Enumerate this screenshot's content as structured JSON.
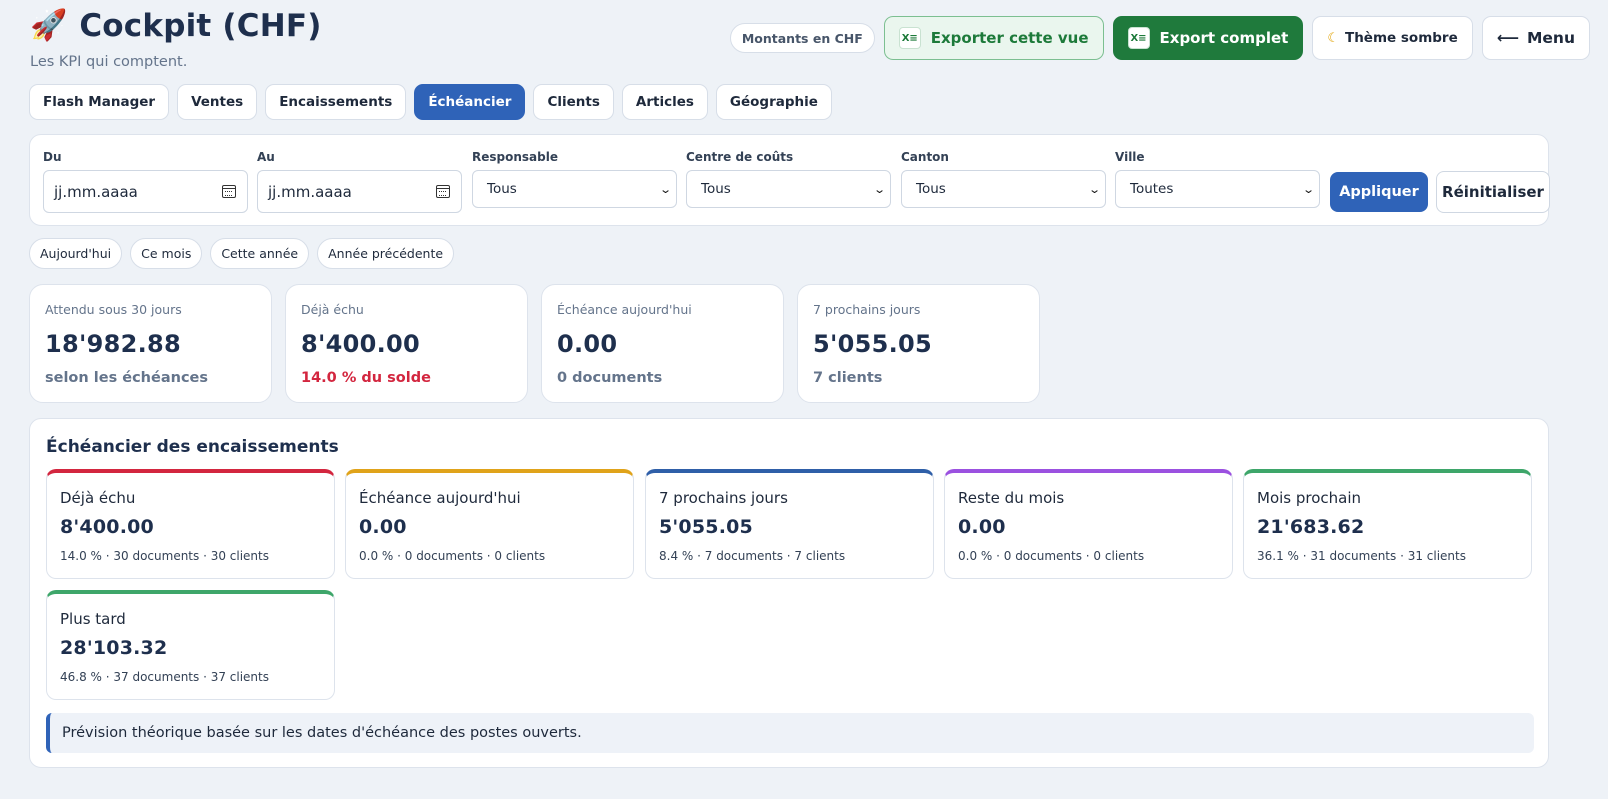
{
  "header": {
    "title": "Cockpit (CHF)",
    "subtitle": "Les KPI qui comptent."
  },
  "top_actions": {
    "currency_pill": "Montants en CHF",
    "export_view": "Exporter cette vue",
    "export_full": "Export complet",
    "theme": "Thème sombre",
    "menu": "Menu",
    "excel_icon_text": "X≡"
  },
  "tabs": [
    {
      "label": "Flash Manager"
    },
    {
      "label": "Ventes"
    },
    {
      "label": "Encaissements"
    },
    {
      "label": "Échéancier",
      "active": true
    },
    {
      "label": "Clients"
    },
    {
      "label": "Articles"
    },
    {
      "label": "Géographie"
    }
  ],
  "filters": {
    "from": {
      "label": "Du",
      "placeholder": "jj.mm.aaaa"
    },
    "to": {
      "label": "Au",
      "placeholder": "jj.mm.aaaa"
    },
    "responsable": {
      "label": "Responsable",
      "value": "Tous"
    },
    "cost_center": {
      "label": "Centre de coûts",
      "value": "Tous"
    },
    "canton": {
      "label": "Canton",
      "value": "Tous"
    },
    "city": {
      "label": "Ville",
      "value": "Toutes"
    },
    "apply": "Appliquer",
    "reset": "Réinitialiser"
  },
  "quick_ranges": [
    "Aujourd'hui",
    "Ce mois",
    "Cette année",
    "Année précédente"
  ],
  "kpis": [
    {
      "label": "Attendu sous 30 jours",
      "value": "18'982.88",
      "sub": "selon les échéances"
    },
    {
      "label": "Déjà échu",
      "value": "8'400.00",
      "sub": "14.0 % du solde",
      "sub_color": "#d3263f"
    },
    {
      "label": "Échéance aujourd'hui",
      "value": "0.00",
      "sub": "0 documents"
    },
    {
      "label": "7 prochains jours",
      "value": "5'055.05",
      "sub": "7 clients"
    }
  ],
  "schedule": {
    "title": "Échéancier des encaissements",
    "buckets": [
      {
        "label": "Déjà échu",
        "value": "8'400.00",
        "meta": "14.0 % · 30 documents · 30 clients",
        "color": "#d3263f"
      },
      {
        "label": "Échéance aujourd'hui",
        "value": "0.00",
        "meta": "0.0 % · 0 documents · 0 clients",
        "color": "#e0a31a"
      },
      {
        "label": "7 prochains jours",
        "value": "5'055.05",
        "meta": "8.4 % · 7 documents · 7 clients",
        "color": "#2f5fa8"
      },
      {
        "label": "Reste du mois",
        "value": "0.00",
        "meta": "0.0 % · 0 documents · 0 clients",
        "color": "#9b51e0"
      },
      {
        "label": "Mois prochain",
        "value": "21'683.62",
        "meta": "36.1 % · 31 documents · 31 clients",
        "color": "#3ea66a"
      },
      {
        "label": "Plus tard",
        "value": "28'103.32",
        "meta": "46.8 % · 37 documents · 37 clients",
        "color": "#3ea66a"
      }
    ],
    "note": "Prévision théorique basée sur les dates d'échéance des postes ouverts."
  }
}
